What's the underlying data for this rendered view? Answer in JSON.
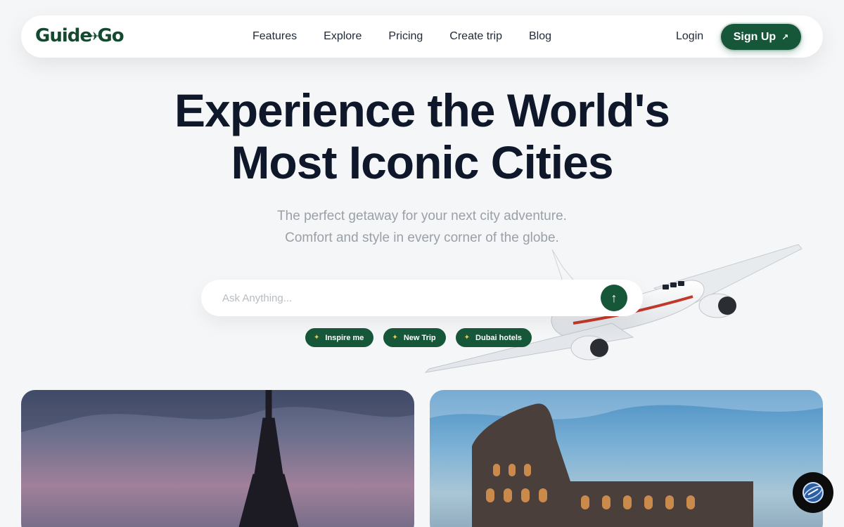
{
  "brand": {
    "logo_left": "Guide",
    "logo_right": "Go"
  },
  "nav": {
    "links": [
      "Features",
      "Explore",
      "Pricing",
      "Create trip",
      "Blog"
    ],
    "login": "Login",
    "signup": "Sign Up"
  },
  "hero": {
    "title_line1": "Experience the World's",
    "title_line2": "Most Iconic Cities",
    "subtitle_line1": "The perfect getaway for your next city adventure.",
    "subtitle_line2": "Comfort and style in every corner of the globe."
  },
  "search": {
    "placeholder": "Ask Anything..."
  },
  "chips": [
    "Inspire me",
    "New Trip",
    "Dubai hotels"
  ],
  "colors": {
    "brand_green": "#16573a",
    "heading": "#0f172a",
    "muted": "#9aa0a8"
  },
  "icons": {
    "send": "arrow-up-icon",
    "signup_arrow": "arrow-up-right-icon",
    "chip": "sparkle-icon"
  }
}
